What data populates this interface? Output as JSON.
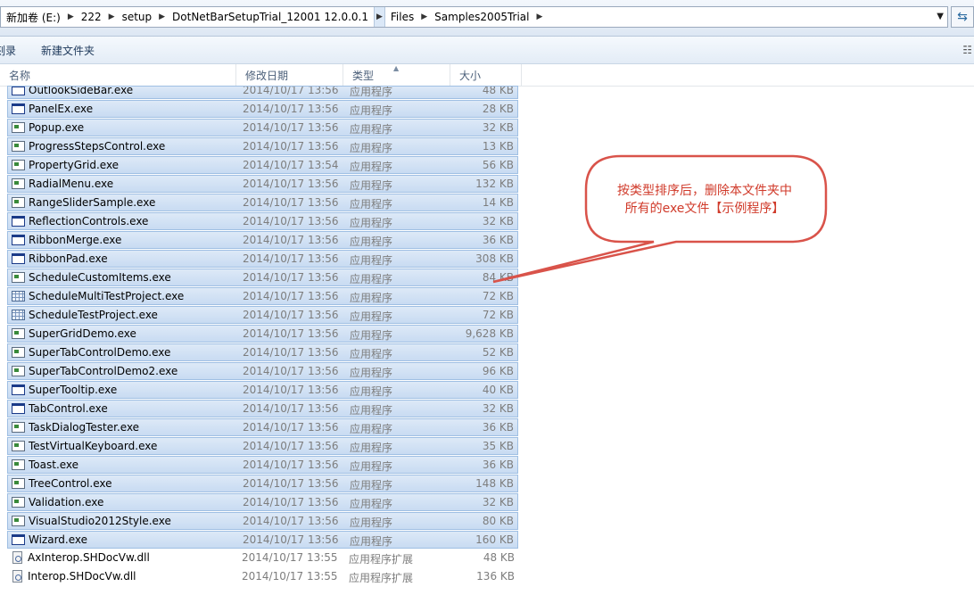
{
  "address": {
    "crumbs": [
      "新加卷 (E:)",
      "222",
      "setup",
      "DotNetBarSetupTrial_12001 12.0.0.1",
      "Files",
      "Samples2005Trial"
    ],
    "dropdown_icon": "chevron-down-icon",
    "refresh_icon": "refresh-icon"
  },
  "toolbar": {
    "left_clipped": "刻录",
    "new_folder": "新建文件夹",
    "view_icon": "view-options-icon"
  },
  "columns": {
    "name": "名称",
    "date": "修改日期",
    "type": "类型",
    "size": "大小"
  },
  "files": [
    {
      "name": "OutlookSideBar.exe",
      "date": "2014/10/17 13:56",
      "type": "应用程序",
      "size": "48 KB",
      "icon": "window",
      "selected": true
    },
    {
      "name": "PanelEx.exe",
      "date": "2014/10/17 13:56",
      "type": "应用程序",
      "size": "28 KB",
      "icon": "window",
      "selected": true
    },
    {
      "name": "Popup.exe",
      "date": "2014/10/17 13:56",
      "type": "应用程序",
      "size": "32 KB",
      "icon": "app",
      "selected": true
    },
    {
      "name": "ProgressStepsControl.exe",
      "date": "2014/10/17 13:56",
      "type": "应用程序",
      "size": "13 KB",
      "icon": "app",
      "selected": true
    },
    {
      "name": "PropertyGrid.exe",
      "date": "2014/10/17 13:54",
      "type": "应用程序",
      "size": "56 KB",
      "icon": "app",
      "selected": true
    },
    {
      "name": "RadialMenu.exe",
      "date": "2014/10/17 13:56",
      "type": "应用程序",
      "size": "132 KB",
      "icon": "app",
      "selected": true
    },
    {
      "name": "RangeSliderSample.exe",
      "date": "2014/10/17 13:56",
      "type": "应用程序",
      "size": "14 KB",
      "icon": "app",
      "selected": true
    },
    {
      "name": "ReflectionControls.exe",
      "date": "2014/10/17 13:56",
      "type": "应用程序",
      "size": "32 KB",
      "icon": "window",
      "selected": true
    },
    {
      "name": "RibbonMerge.exe",
      "date": "2014/10/17 13:56",
      "type": "应用程序",
      "size": "36 KB",
      "icon": "window",
      "selected": true
    },
    {
      "name": "RibbonPad.exe",
      "date": "2014/10/17 13:56",
      "type": "应用程序",
      "size": "308 KB",
      "icon": "window",
      "selected": true
    },
    {
      "name": "ScheduleCustomItems.exe",
      "date": "2014/10/17 13:56",
      "type": "应用程序",
      "size": "84 KB",
      "icon": "app",
      "selected": true
    },
    {
      "name": "ScheduleMultiTestProject.exe",
      "date": "2014/10/17 13:56",
      "type": "应用程序",
      "size": "72 KB",
      "icon": "grid",
      "selected": true
    },
    {
      "name": "ScheduleTestProject.exe",
      "date": "2014/10/17 13:56",
      "type": "应用程序",
      "size": "72 KB",
      "icon": "grid",
      "selected": true
    },
    {
      "name": "SuperGridDemo.exe",
      "date": "2014/10/17 13:56",
      "type": "应用程序",
      "size": "9,628 KB",
      "icon": "app",
      "selected": true
    },
    {
      "name": "SuperTabControlDemo.exe",
      "date": "2014/10/17 13:56",
      "type": "应用程序",
      "size": "52 KB",
      "icon": "app",
      "selected": true
    },
    {
      "name": "SuperTabControlDemo2.exe",
      "date": "2014/10/17 13:56",
      "type": "应用程序",
      "size": "96 KB",
      "icon": "app",
      "selected": true
    },
    {
      "name": "SuperTooltip.exe",
      "date": "2014/10/17 13:56",
      "type": "应用程序",
      "size": "40 KB",
      "icon": "window",
      "selected": true
    },
    {
      "name": "TabControl.exe",
      "date": "2014/10/17 13:56",
      "type": "应用程序",
      "size": "32 KB",
      "icon": "window",
      "selected": true
    },
    {
      "name": "TaskDialogTester.exe",
      "date": "2014/10/17 13:56",
      "type": "应用程序",
      "size": "36 KB",
      "icon": "app",
      "selected": true
    },
    {
      "name": "TestVirtualKeyboard.exe",
      "date": "2014/10/17 13:56",
      "type": "应用程序",
      "size": "35 KB",
      "icon": "app",
      "selected": true
    },
    {
      "name": "Toast.exe",
      "date": "2014/10/17 13:56",
      "type": "应用程序",
      "size": "36 KB",
      "icon": "app",
      "selected": true
    },
    {
      "name": "TreeControl.exe",
      "date": "2014/10/17 13:56",
      "type": "应用程序",
      "size": "148 KB",
      "icon": "app",
      "selected": true
    },
    {
      "name": "Validation.exe",
      "date": "2014/10/17 13:56",
      "type": "应用程序",
      "size": "32 KB",
      "icon": "app",
      "selected": true
    },
    {
      "name": "VisualStudio2012Style.exe",
      "date": "2014/10/17 13:56",
      "type": "应用程序",
      "size": "80 KB",
      "icon": "app",
      "selected": true
    },
    {
      "name": "Wizard.exe",
      "date": "2014/10/17 13:56",
      "type": "应用程序",
      "size": "160 KB",
      "icon": "window",
      "selected": true
    },
    {
      "name": "AxInterop.SHDocVw.dll",
      "date": "2014/10/17 13:55",
      "type": "应用程序扩展",
      "size": "48 KB",
      "icon": "dll",
      "selected": false
    },
    {
      "name": "Interop.SHDocVw.dll",
      "date": "2014/10/17 13:55",
      "type": "应用程序扩展",
      "size": "136 KB",
      "icon": "dll",
      "selected": false
    }
  ],
  "callout": {
    "line1": "按类型排序后，删除本文件夹中",
    "line2": "所有的exe文件【示例程序】",
    "color": "#d03a2a"
  }
}
